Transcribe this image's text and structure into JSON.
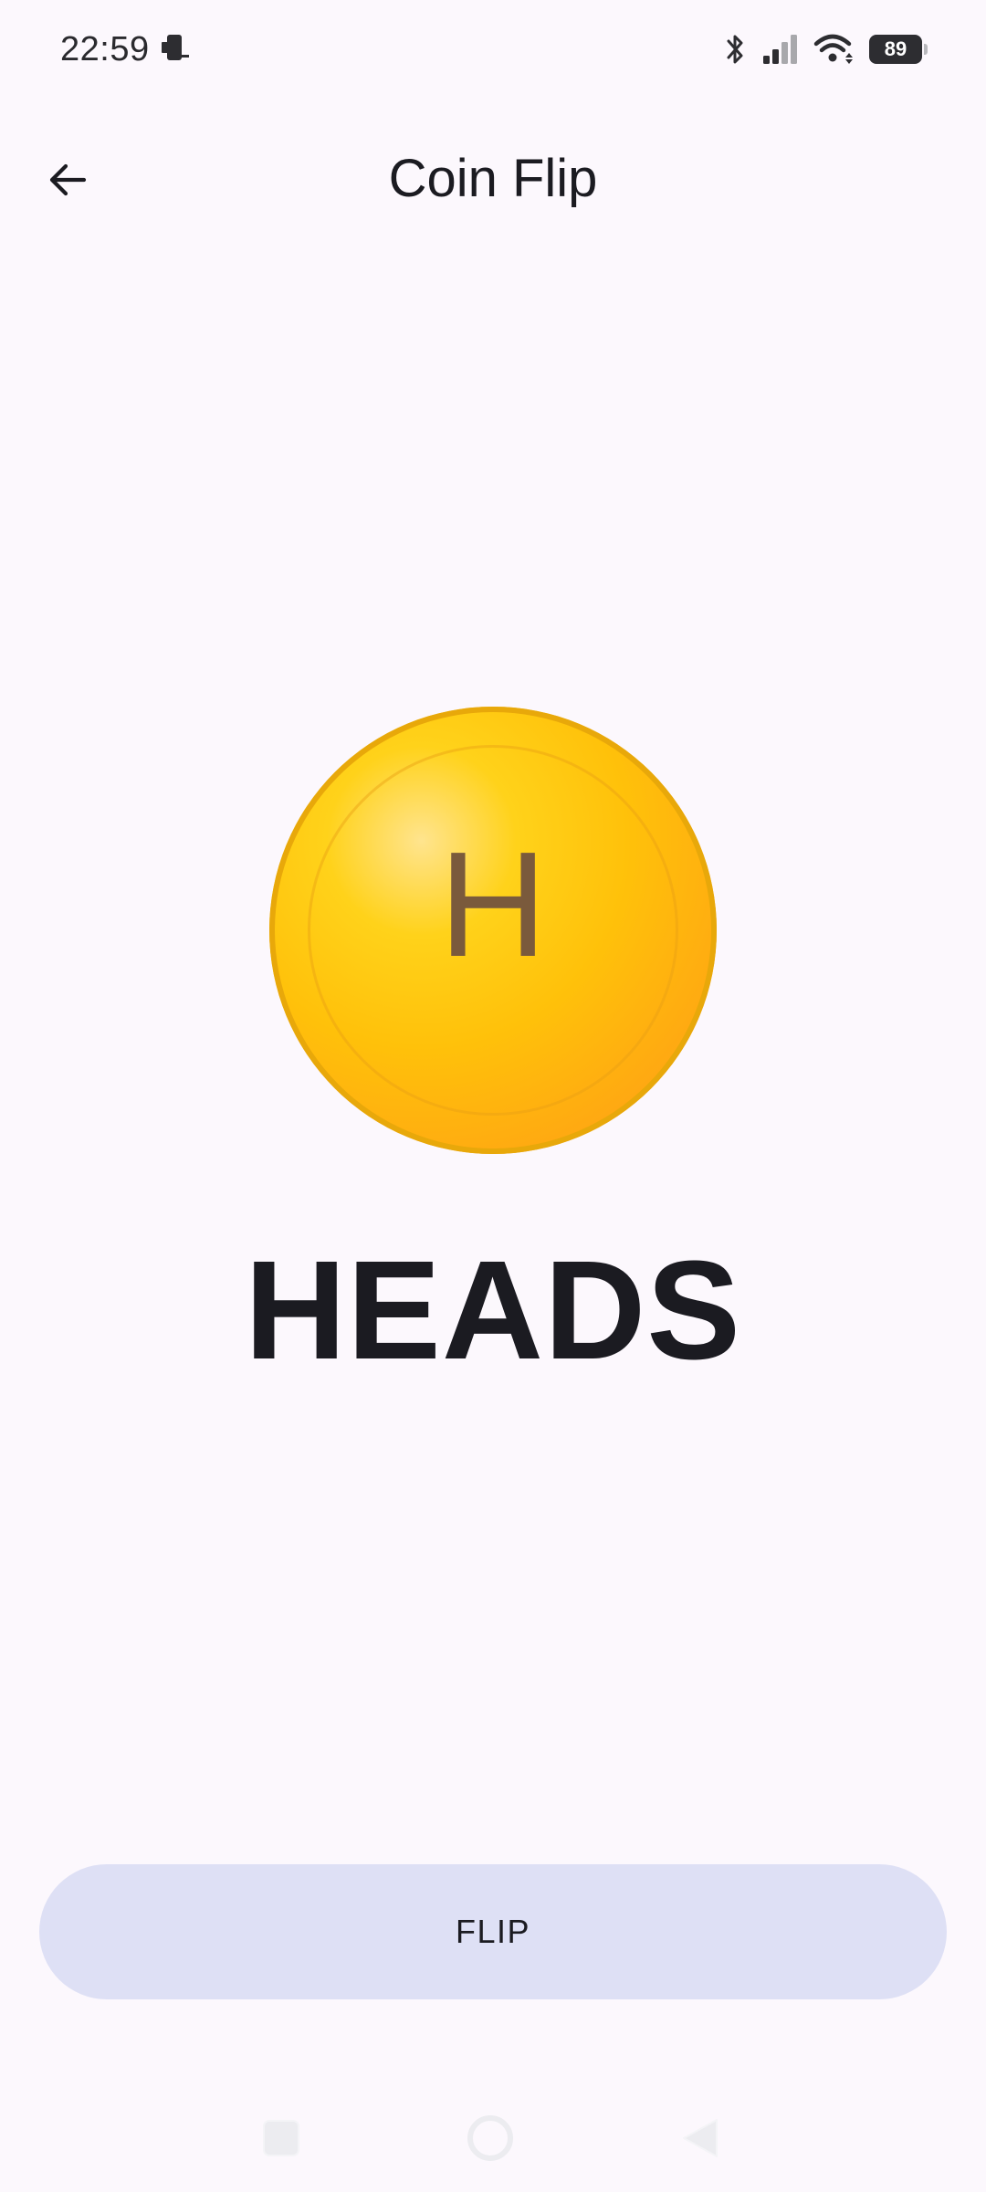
{
  "status_bar": {
    "time": "22:59",
    "battery": "89",
    "icons": [
      "notification-icon",
      "bluetooth-icon",
      "signal-icon",
      "wifi-icon",
      "battery-icon"
    ]
  },
  "app_bar": {
    "title": "Coin Flip",
    "back_icon": "arrow-back-icon"
  },
  "coin": {
    "face_letter": "H",
    "colors": {
      "highlight": "#ffe48e",
      "base": "#ffc10a",
      "edge": "#ff9a00",
      "letter": "#7a5a3c"
    }
  },
  "result": {
    "text": "HEADS"
  },
  "flip_button": {
    "label": "FLIP",
    "background": "#dee0f5"
  },
  "nav_bar": {
    "icons": [
      "recent-apps-icon",
      "home-icon",
      "back-triangle-icon"
    ]
  }
}
